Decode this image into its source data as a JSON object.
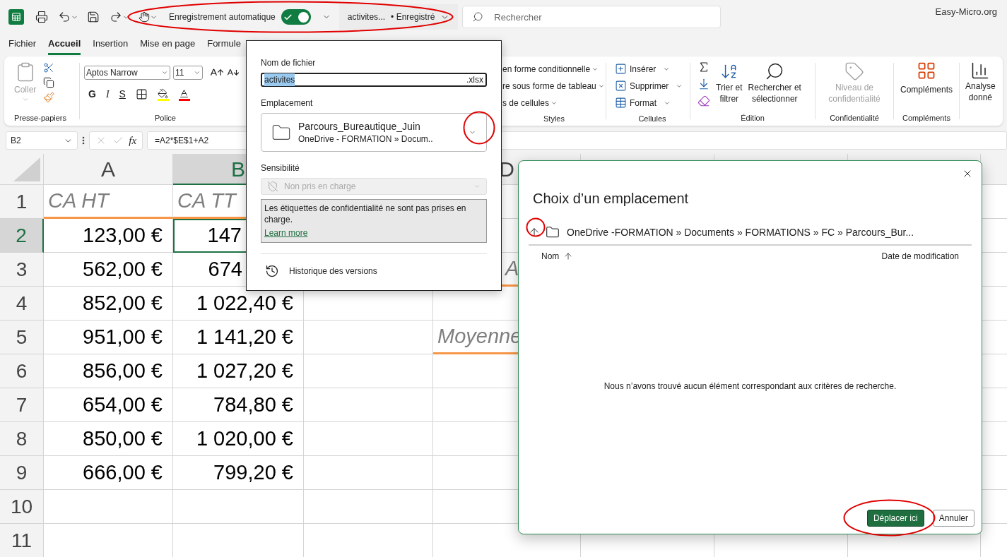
{
  "titlebar": {
    "autosave_label": "Enregistrement automatique",
    "autosave_on": true,
    "filename": "activites...",
    "save_status": "• Enregistré",
    "search_placeholder": "Rechercher",
    "site": "Easy-Micro.org"
  },
  "menu_tabs": [
    {
      "label": "Fichier",
      "selected": false
    },
    {
      "label": "Accueil",
      "selected": true
    },
    {
      "label": "Insertion",
      "selected": false
    },
    {
      "label": "Mise en page",
      "selected": false
    },
    {
      "label": "Formule",
      "selected": false
    }
  ],
  "ribbon": {
    "clipboard": {
      "paste": "Coller",
      "paste_disabled": true,
      "label": "Presse-papiers"
    },
    "font": {
      "name": "Aptos Narrow",
      "size": "11",
      "bold": "G",
      "italic": "I",
      "underline": "S",
      "label": "Police"
    },
    "styles": {
      "items": [
        "en forme conditionnelle",
        "re sous forme de tableau",
        "s de cellules"
      ],
      "label": "Styles"
    },
    "cells": {
      "items": [
        "Insérer",
        "Supprimer",
        "Format"
      ],
      "label": "Cellules"
    },
    "editing": {
      "sort": [
        "Trier et",
        "filtrer"
      ],
      "find": [
        "Rechercher et",
        "sélectionner"
      ],
      "label": "Édition"
    },
    "sensitivity": {
      "button": [
        "Niveau de",
        "confidentialité"
      ],
      "disabled": true,
      "label": "Confidentialité"
    },
    "addins": {
      "button": "Compléments",
      "label": "Compléments"
    },
    "analysis": {
      "button": [
        "Analyse",
        "donné"
      ]
    }
  },
  "formula_bar": {
    "cell_ref": "B2",
    "fx_label": "fx",
    "formula": "=A2*$E$1+A2"
  },
  "sheet": {
    "columns": [
      {
        "kind": "label",
        "label": "A",
        "selected": false
      },
      {
        "kind": "label",
        "label": "B",
        "selected": true
      },
      {
        "kind": "blank"
      },
      {
        "kind": "label",
        "label": "D",
        "selected": false
      }
    ],
    "rows": [
      {
        "number": "1",
        "selected": false,
        "cells": [
          {
            "kind": "label",
            "text": "CA HT",
            "selected": false
          },
          {
            "kind": "label",
            "text": "CA TT",
            "selected": false
          }
        ]
      },
      {
        "number": "2",
        "selected": true,
        "cells": [
          {
            "kind": "amount",
            "text": "123,00 €",
            "selected": false
          },
          {
            "kind": "amount",
            "text": "147",
            "selected": true
          }
        ]
      },
      {
        "number": "3",
        "selected": false,
        "cells": [
          {
            "kind": "amount",
            "text": "562,00 €",
            "selected": false
          },
          {
            "kind": "amount",
            "text": "674",
            "selected": false
          },
          {
            "kind": "blank"
          },
          {
            "kind": "label",
            "text": "A",
            "selected": false
          }
        ]
      },
      {
        "number": "4",
        "selected": false,
        "cells": [
          {
            "kind": "amount",
            "text": "852,00 €",
            "selected": false
          },
          {
            "kind": "amount",
            "text": "1 022,40 €",
            "selected": false
          }
        ]
      },
      {
        "number": "5",
        "selected": false,
        "cells": [
          {
            "kind": "amount",
            "text": "951,00 €",
            "selected": false
          },
          {
            "kind": "amount",
            "text": "1 141,20 €",
            "selected": false
          },
          {
            "kind": "blank",
            "selected": false
          },
          {
            "kind": "label",
            "text": "Moyenne",
            "selected": false
          }
        ]
      },
      {
        "number": "6",
        "selected": false,
        "cells": [
          {
            "kind": "amount",
            "text": "856,00 €",
            "selected": false
          },
          {
            "kind": "amount",
            "text": "1 027,20 €",
            "selected": false
          }
        ]
      },
      {
        "number": "7",
        "selected": false,
        "cells": [
          {
            "kind": "amount",
            "text": "654,00 €",
            "selected": false
          },
          {
            "kind": "amount",
            "text": "784,80 €",
            "selected": false
          }
        ]
      },
      {
        "number": "8",
        "selected": false,
        "cells": [
          {
            "kind": "amount",
            "text": "850,00 €",
            "selected": false
          },
          {
            "kind": "amount",
            "text": "1 020,00 €",
            "selected": false
          }
        ]
      },
      {
        "number": "9",
        "selected": false,
        "cells": [
          {
            "kind": "amount",
            "text": "666,00 €",
            "selected": false
          },
          {
            "kind": "amount",
            "text": "799,20 €",
            "selected": false
          }
        ]
      },
      {
        "number": "10",
        "selected": false
      },
      {
        "number": "11",
        "selected": false
      }
    ]
  },
  "save_popup": {
    "filename_label": "Nom de fichier",
    "filename": "activites",
    "extension": ".xlsx",
    "location_label": "Emplacement",
    "location_name": "Parcours_Bureautique_Juin",
    "location_path": "OneDrive - FORMATION » Docum..",
    "sensitivity_label": "Sensibilité",
    "sensitivity_value": "Non pris en charge",
    "sensitivity_disabled": true,
    "notice": "Les étiquettes de confidentialité ne sont pas prises en charge.",
    "learn_more": "Learn more",
    "version_history": "Historique des versions"
  },
  "location_dialog": {
    "title": "Choix d’un emplacement",
    "breadcrumb": "OneDrive -FORMATION » Documents » FORMATIONS » FC » Parcours_Bur...",
    "columns": [
      {
        "label": "Nom",
        "sorted": true
      },
      {
        "label": "Date de modification",
        "sorted": false
      }
    ],
    "empty_message": "Nous n’avons trouvé aucun élément correspondant aux critères de recherche.",
    "buttons": [
      {
        "label": "Déplacer ici",
        "kind": "primary"
      },
      {
        "label": "Annuler",
        "kind": "secondary"
      }
    ]
  }
}
